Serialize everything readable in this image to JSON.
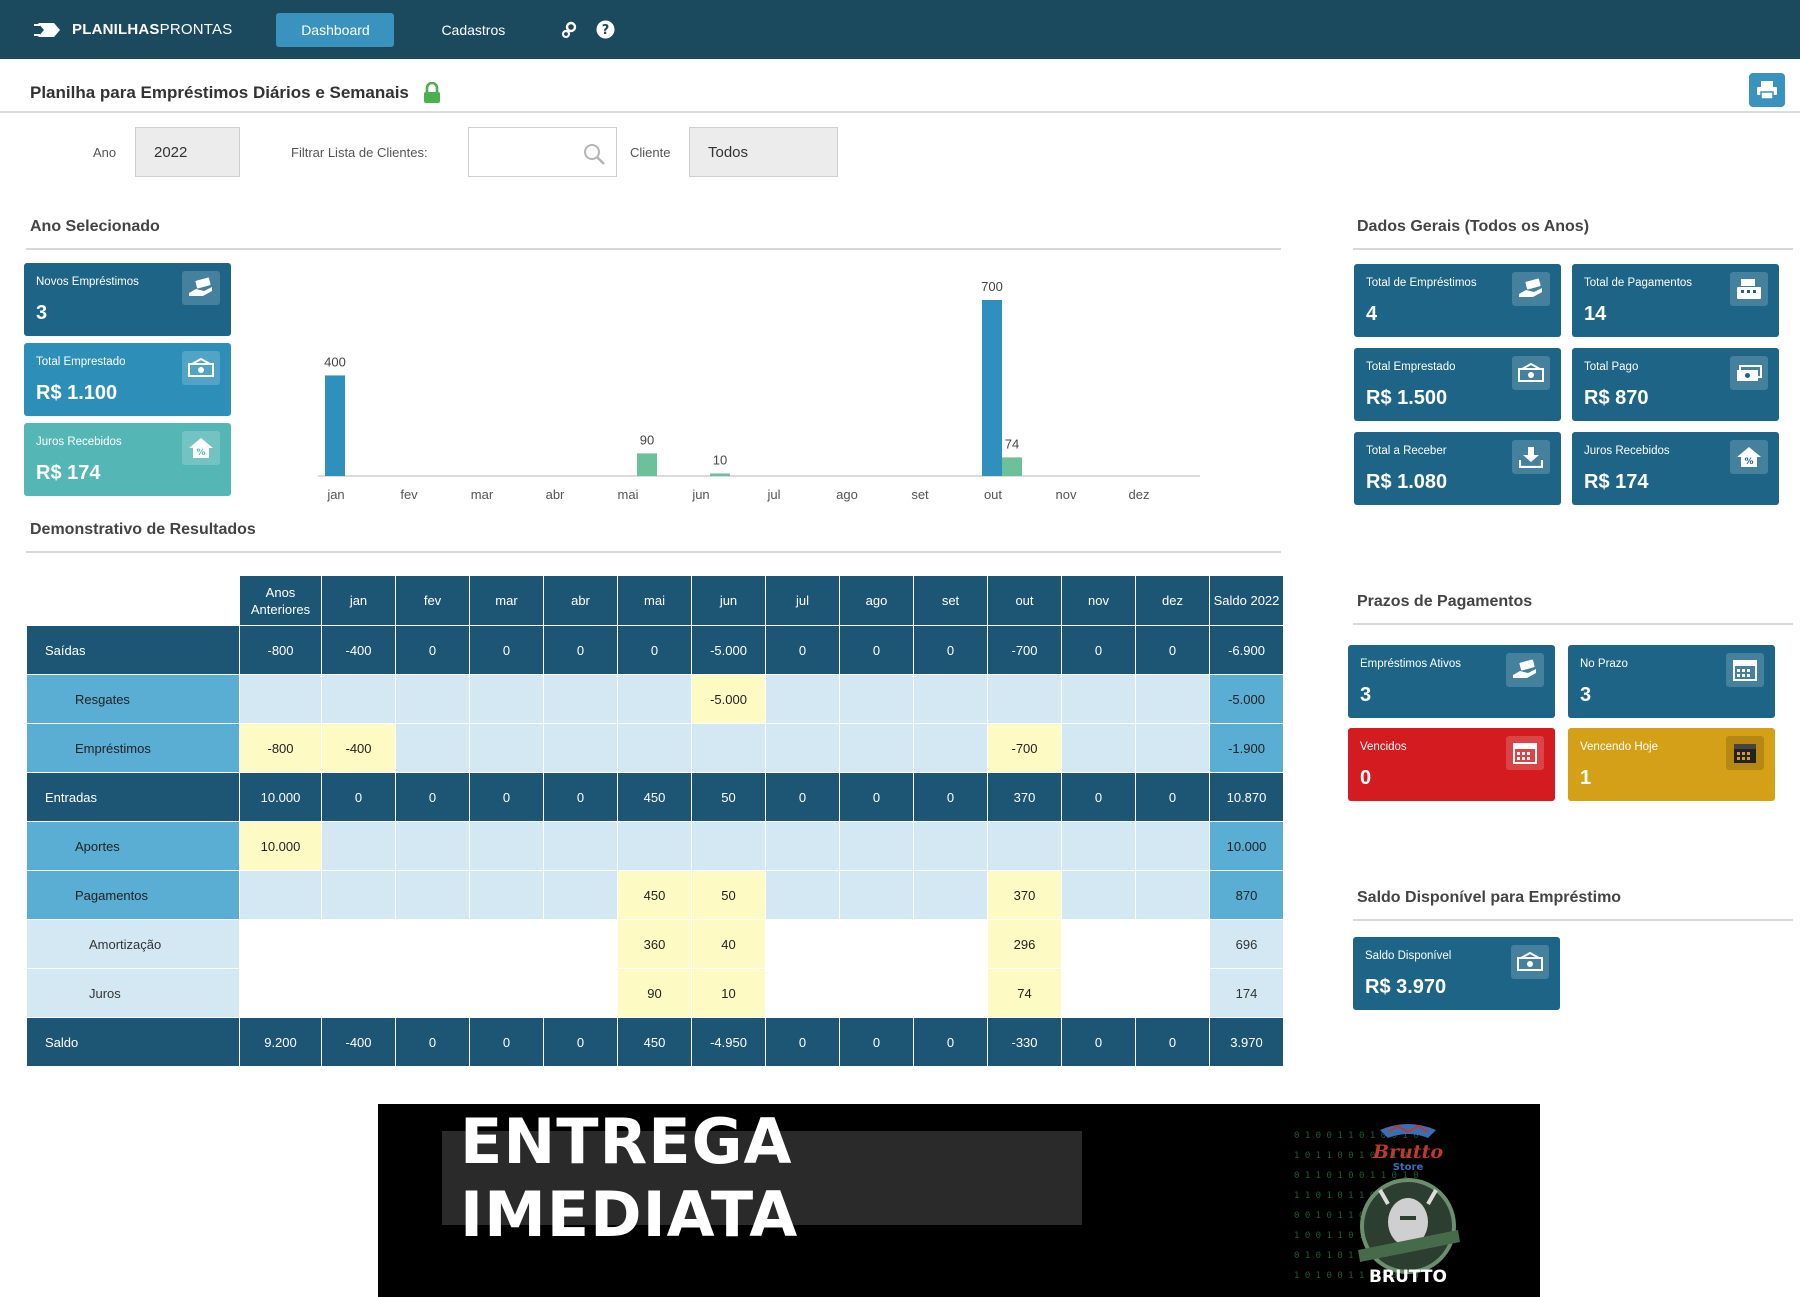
{
  "nav": {
    "brand_bold": "PLANILHAS",
    "brand_light": "PRONTAS",
    "dashboard": "Dashboard",
    "cadastros": "Cadastros"
  },
  "page": {
    "title": "Planilha para Empréstimos Diários e Semanais"
  },
  "filters": {
    "ano_label": "Ano",
    "ano_value": "2022",
    "filtrar_label": "Filtrar Lista de Clientes:",
    "filtrar_value": "",
    "cliente_label": "Cliente",
    "cliente_value": "Todos"
  },
  "sections": {
    "ano_selecionado": "Ano Selecionado",
    "demonstrativo": "Demonstrativo de Resultados",
    "dados_gerais": "Dados Gerais (Todos os Anos)",
    "prazos": "Prazos de Pagamentos",
    "saldo": "Saldo Disponível para Empréstimo"
  },
  "ano_cards": [
    {
      "label": "Novos Empréstimos",
      "value": "3",
      "icon": "hand-money-icon"
    },
    {
      "label": "Total Emprestado",
      "value": "R$ 1.100",
      "icon": "cash-icon"
    },
    {
      "label": "Juros Recebidos",
      "value": "R$ 174",
      "icon": "house-percent-icon"
    }
  ],
  "gerais_cards": [
    {
      "label": "Total de Empréstimos",
      "value": "4",
      "icon": "hand-money-icon"
    },
    {
      "label": "Total de Pagamentos",
      "value": "14",
      "icon": "register-icon"
    },
    {
      "label": "Total Emprestado",
      "value": "R$ 1.500",
      "icon": "cash-icon"
    },
    {
      "label": "Total Pago",
      "value": "R$ 870",
      "icon": "cash-stack-icon"
    },
    {
      "label": "Total a Receber",
      "value": "R$ 1.080",
      "icon": "download-icon"
    },
    {
      "label": "Juros Recebidos",
      "value": "R$ 174",
      "icon": "house-percent-icon"
    }
  ],
  "prazos_cards": [
    {
      "label": "Empréstimos Ativos",
      "value": "3",
      "icon": "hand-money-icon"
    },
    {
      "label": "No Prazo",
      "value": "3",
      "icon": "calendar-icon"
    },
    {
      "label": "Vencidos",
      "value": "0",
      "icon": "calendar-icon"
    },
    {
      "label": "Vencendo Hoje",
      "value": "1",
      "icon": "calendar-icon"
    }
  ],
  "saldo_card": {
    "label": "Saldo Disponível",
    "value": "R$ 3.970",
    "icon": "cash-icon"
  },
  "chart_data": {
    "type": "bar",
    "categories": [
      "jan",
      "fev",
      "mar",
      "abr",
      "mai",
      "jun",
      "jul",
      "ago",
      "set",
      "out",
      "nov",
      "dez"
    ],
    "series": [
      {
        "values": [
          400,
          0,
          0,
          0,
          0,
          0,
          0,
          0,
          0,
          700,
          0,
          0
        ],
        "color": "#2f8fbd"
      },
      {
        "values": [
          0,
          0,
          0,
          0,
          90,
          10,
          0,
          0,
          0,
          74,
          0,
          0
        ],
        "color": "#6cc09a"
      }
    ],
    "ylim": [
      0,
      700
    ],
    "grid": false,
    "legend": "none"
  },
  "table": {
    "header": [
      "Anos Anteriores",
      "jan",
      "fev",
      "mar",
      "abr",
      "mai",
      "jun",
      "jul",
      "ago",
      "set",
      "out",
      "nov",
      "dez",
      "Saldo 2022"
    ],
    "rows": [
      {
        "label": "Saídas",
        "style": "dark",
        "cells": [
          "-800",
          "-400",
          "0",
          "0",
          "0",
          "0",
          "-5.000",
          "0",
          "0",
          "0",
          "-700",
          "0",
          "0",
          "-6.900"
        ]
      },
      {
        "label": "Resgates",
        "style": "mid",
        "cells": [
          "",
          "",
          "",
          "",
          "",
          "",
          "-5.000",
          "",
          "",
          "",
          "",
          "",
          "",
          "-5.000"
        ],
        "highlight": [
          6
        ]
      },
      {
        "label": "Empréstimos",
        "style": "mid",
        "cells": [
          "-800",
          "-400",
          "",
          "",
          "",
          "",
          "",
          "",
          "",
          "",
          "-700",
          "",
          "",
          "-1.900"
        ],
        "highlight": [
          0,
          1,
          10
        ]
      },
      {
        "label": "Entradas",
        "style": "dark",
        "cells": [
          "10.000",
          "0",
          "0",
          "0",
          "0",
          "450",
          "50",
          "0",
          "0",
          "0",
          "370",
          "0",
          "0",
          "10.870"
        ]
      },
      {
        "label": "Aportes",
        "style": "mid",
        "cells": [
          "10.000",
          "",
          "",
          "",
          "",
          "",
          "",
          "",
          "",
          "",
          "",
          "",
          "",
          "10.000"
        ],
        "highlight": [
          0
        ]
      },
      {
        "label": "Pagamentos",
        "style": "mid",
        "cells": [
          "",
          "",
          "",
          "",
          "",
          "450",
          "50",
          "",
          "",
          "",
          "370",
          "",
          "",
          "870"
        ],
        "highlight": [
          5,
          6,
          10
        ]
      },
      {
        "label": "Amortização",
        "style": "light",
        "cells": [
          "",
          "",
          "",
          "",
          "",
          "360",
          "40",
          "",
          "",
          "",
          "296",
          "",
          "",
          "696"
        ],
        "highlight": [
          5,
          6,
          10
        ]
      },
      {
        "label": "Juros",
        "style": "light",
        "cells": [
          "",
          "",
          "",
          "",
          "",
          "90",
          "10",
          "",
          "",
          "",
          "74",
          "",
          "",
          "174"
        ],
        "highlight": [
          5,
          6,
          10
        ]
      },
      {
        "label": "Saldo",
        "style": "dark",
        "cells": [
          "9.200",
          "-400",
          "0",
          "0",
          "0",
          "450",
          "-4.950",
          "0",
          "0",
          "0",
          "-330",
          "0",
          "0",
          "3.970"
        ]
      }
    ]
  },
  "banner": {
    "text": "ENTREGA IMEDIATA",
    "brand_name": "Brutto",
    "brand_sub": "Store",
    "brand_mark": "BRUTTO"
  }
}
